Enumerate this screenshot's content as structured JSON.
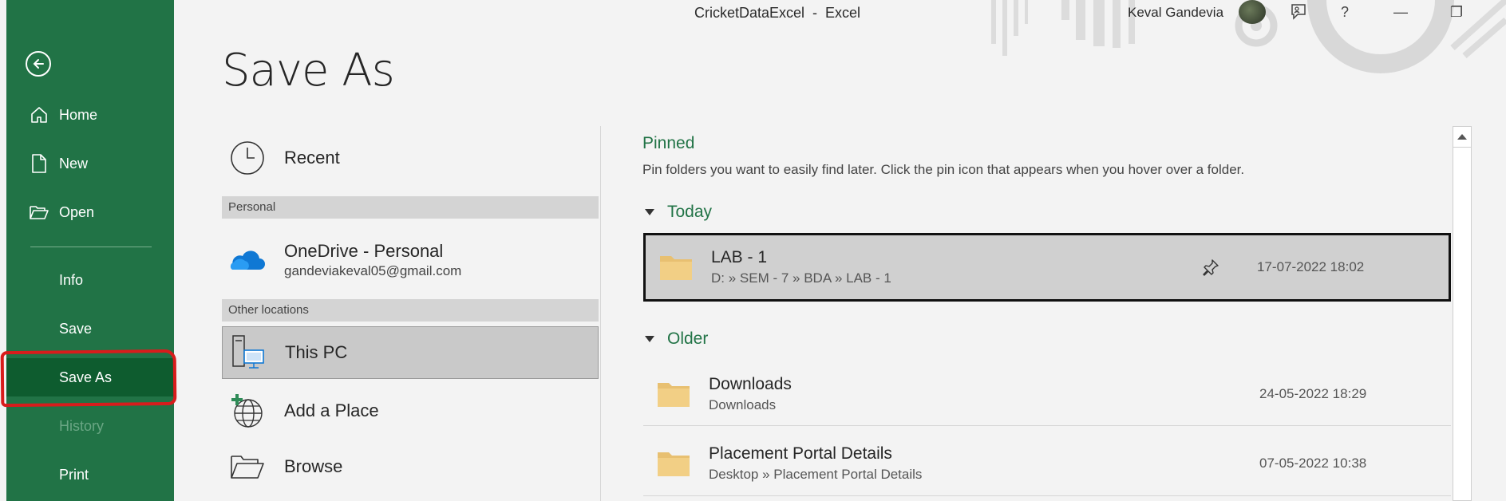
{
  "window": {
    "title": "CricketDataExcel  -  Excel",
    "user_name": "Keval Gandevia",
    "help_label": "?",
    "minimize_label": "—",
    "restore_label": "❐"
  },
  "sidebar": {
    "back_icon": "back-arrow-icon",
    "items": [
      {
        "label": "Home",
        "icon": "home-icon"
      },
      {
        "label": "New",
        "icon": "new-document-icon"
      },
      {
        "label": "Open",
        "icon": "open-folder-icon"
      },
      {
        "label": "Info"
      },
      {
        "label": "Save"
      },
      {
        "label": "Save As",
        "active": true
      },
      {
        "label": "History",
        "disabled": true
      },
      {
        "label": "Print"
      }
    ],
    "accent_color": "#217346",
    "active_color": "#0e5c2f",
    "highlight_color": "#d81c1c"
  },
  "page": {
    "title": "Save As"
  },
  "locations": {
    "recent": "Recent",
    "personal_header": "Personal",
    "onedrive_title": "OneDrive - Personal",
    "onedrive_email": "gandeviakeval05@gmail.com",
    "other_header": "Other locations",
    "this_pc": "This PC",
    "add_place": "Add a Place",
    "browse": "Browse"
  },
  "pane": {
    "pinned_title": "Pinned",
    "pinned_desc": "Pin folders you want to easily find later. Click the pin icon that appears when you hover over a folder.",
    "today_header": "Today",
    "older_header": "Older",
    "today_rows": [
      {
        "name": "LAB - 1",
        "path": "D: » SEM - 7 » BDA » LAB - 1",
        "date": "17-07-2022 18:02"
      }
    ],
    "older_rows": [
      {
        "name": "Downloads",
        "path": "Downloads",
        "date": "24-05-2022 18:29"
      },
      {
        "name": "Placement Portal Details",
        "path": "Desktop » Placement Portal Details",
        "date": "07-05-2022 10:38"
      }
    ]
  }
}
